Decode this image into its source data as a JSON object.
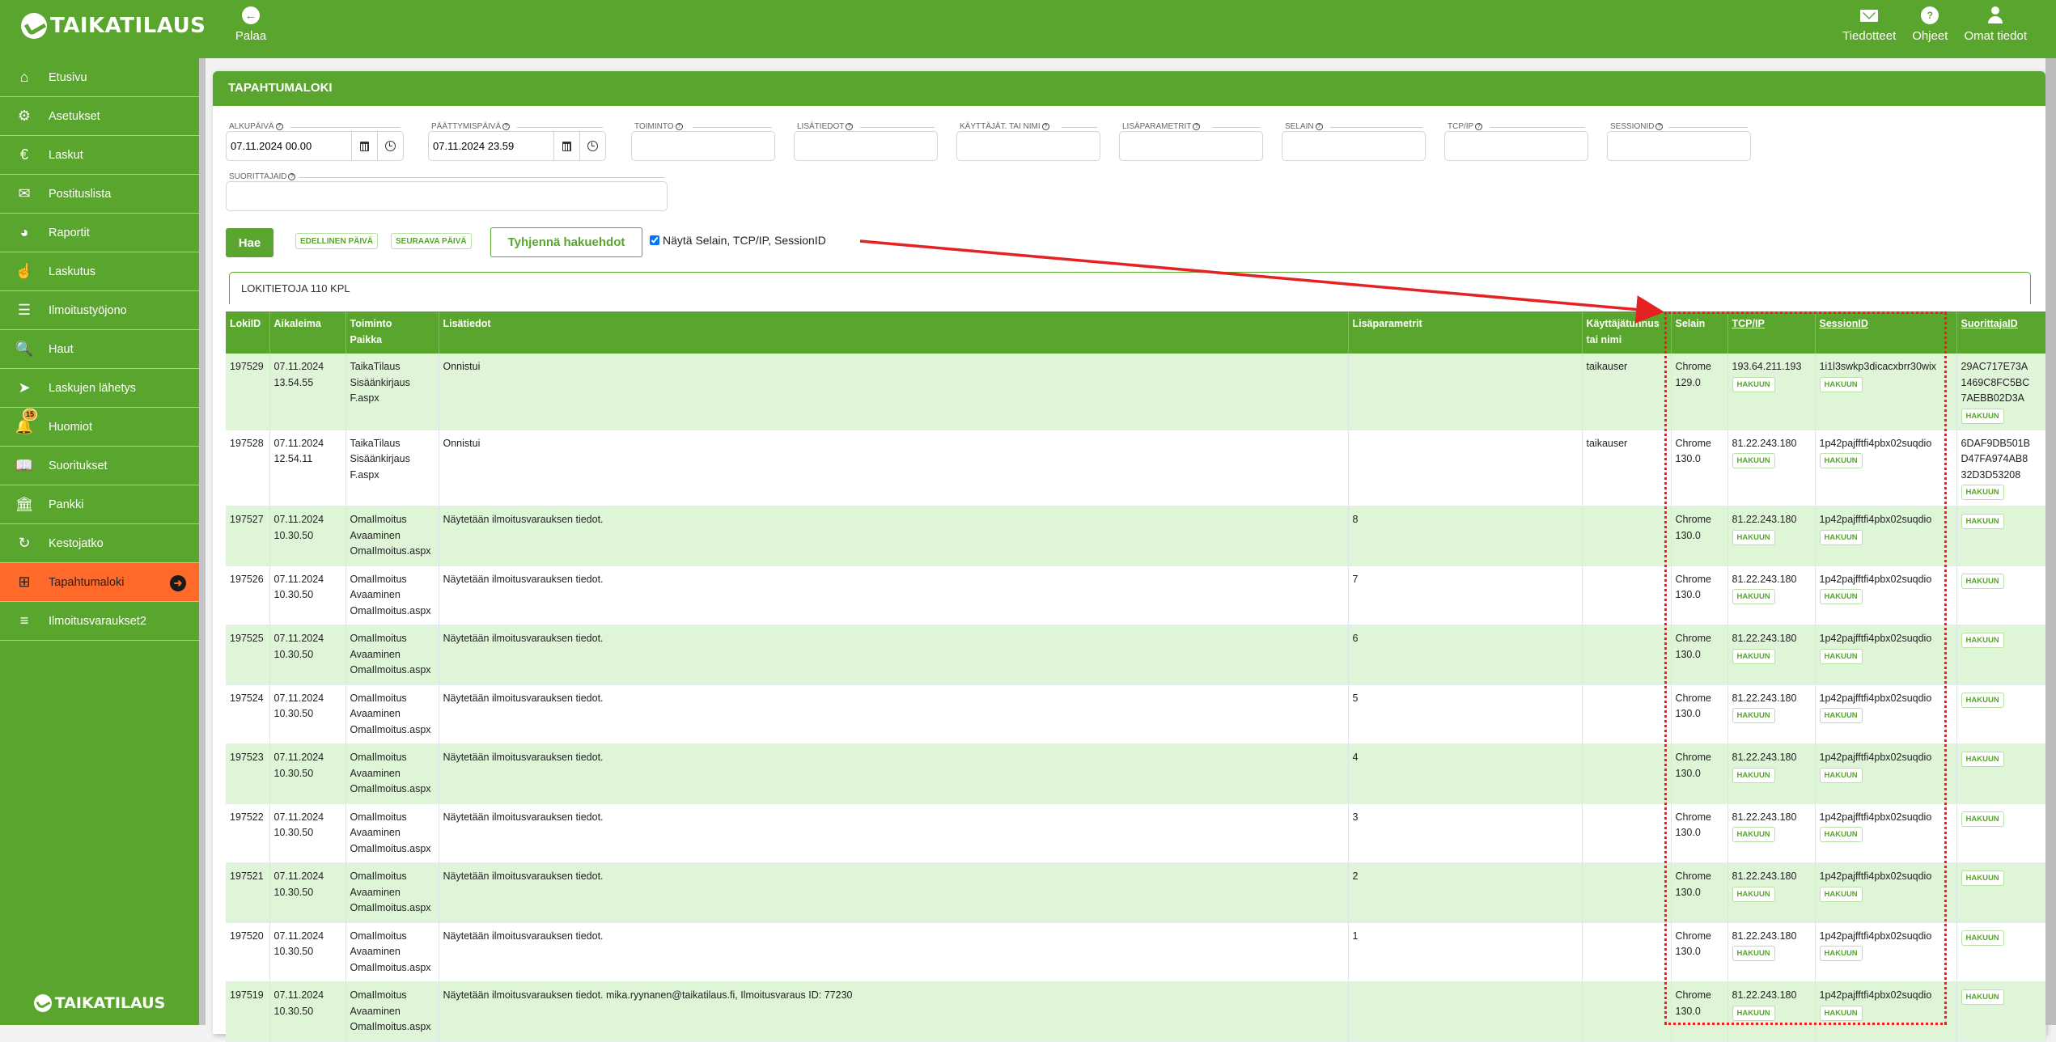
{
  "app": {
    "brand": "TAIKATILAUS",
    "back_label": "Palaa",
    "top_actions": [
      {
        "label": "Tiedotteet",
        "icon": "envelope-icon"
      },
      {
        "label": "Ohjeet",
        "icon": "question-icon"
      },
      {
        "label": "Omat tiedot",
        "icon": "user-icon"
      }
    ]
  },
  "sidebar": {
    "items": [
      {
        "label": "Etusivu",
        "icon": "home-icon"
      },
      {
        "label": "Asetukset",
        "icon": "gear-icon"
      },
      {
        "label": "Laskut",
        "icon": "euro-icon"
      },
      {
        "label": "Postituslista",
        "icon": "envelope-icon"
      },
      {
        "label": "Raportit",
        "icon": "pie-chart-icon"
      },
      {
        "label": "Laskutus",
        "icon": "thumbs-up-icon"
      },
      {
        "label": "Ilmoitustyöjono",
        "icon": "list-icon"
      },
      {
        "label": "Haut",
        "icon": "search-plus-icon"
      },
      {
        "label": "Laskujen lähetys",
        "icon": "paper-plane-icon"
      },
      {
        "label": "Huomiot",
        "icon": "bell-icon",
        "badge": "15"
      },
      {
        "label": "Suoritukset",
        "icon": "book-icon"
      },
      {
        "label": "Pankki",
        "icon": "bank-icon"
      },
      {
        "label": "Kestojatko",
        "icon": "refresh-icon"
      },
      {
        "label": "Tapahtumaloki",
        "icon": "grid-icon",
        "active": true
      },
      {
        "label": "Ilmoitusvaraukset2",
        "icon": "indent-list-icon"
      }
    ],
    "footer_brand": "TAIKATILAUS"
  },
  "page": {
    "title": "TAPAHTUMALOKI",
    "filters": {
      "alkupaiva": {
        "label": "ALKUPÄIVÄ",
        "value": "07.11.2024 00.00"
      },
      "paattymispaiva": {
        "label": "PÄÄTTYMISPÄIVÄ",
        "value": "07.11.2024 23.59"
      },
      "toiminto": {
        "label": "TOIMINTO",
        "value": ""
      },
      "lisatiedot": {
        "label": "LISÄTIEDOT",
        "value": ""
      },
      "kayttajat": {
        "label": "KÄYTTÄJÄT. TAI NIMI",
        "value": ""
      },
      "lisaparametrit": {
        "label": "LISÄPARAMETRIT",
        "value": ""
      },
      "selain": {
        "label": "SELAIN",
        "value": ""
      },
      "tcpip": {
        "label": "TCP/IP",
        "value": ""
      },
      "sessionid": {
        "label": "SESSIONID",
        "value": ""
      },
      "suorittajaid": {
        "label": "SUORITTAJAID",
        "value": ""
      }
    },
    "buttons": {
      "search": "Hae",
      "prev_day": "EDELLINEN PÄIVÄ",
      "next_day": "SEURAAVA PÄIVÄ",
      "clear": "Tyhjennä hakuehdot"
    },
    "show_extra_checkbox": {
      "label": "Näytä Selain, TCP/IP, SessionID",
      "checked": true
    },
    "count_text": "LOKITIETOJA 110 KPL",
    "hakuun_label": "HAKUUN"
  },
  "table": {
    "headers": {
      "lokiid": "LokiID",
      "aikaleima": "Aikaleima",
      "toiminto": "Toiminto\nPaikka",
      "lisatiedot": "Lisätiedot",
      "lisaparametrit": "Lisäparametrit",
      "kayttaja": "Käyttäjätunnus\ntai nimi",
      "selain": "Selain",
      "tcpip": "TCP/IP",
      "sessionid": "SessionID",
      "suorittajaid": "SuorittajaID"
    },
    "rows": [
      {
        "id": "197529",
        "time": "07.11.2024\n13.54.55",
        "action": "TaikaTilaus\nSisäänkirjaus\nF.aspx",
        "info": "Onnistui",
        "params": "",
        "user": "taikauser",
        "browser": "Chrome\n129.0",
        "ip": "193.64.211.193",
        "session": "1i1l3swkp3dicacxbrr30wix",
        "performer": "29AC717E73A\n1469C8FC5BC\n7AEBB02D3A"
      },
      {
        "id": "197528",
        "time": "07.11.2024\n12.54.11",
        "action": "TaikaTilaus\nSisäänkirjaus\nF.aspx",
        "info": "Onnistui",
        "params": "",
        "user": "taikauser",
        "browser": "Chrome\n130.0",
        "ip": "81.22.243.180",
        "session": "1p42pajfftfi4pbx02suqdio",
        "performer": "6DAF9DB501B\nD47FA974AB8\n32D3D53208"
      },
      {
        "id": "197527",
        "time": "07.11.2024\n10.30.50",
        "action": "OmaIlmoitus\nAvaaminen\nOmaIlmoitus.aspx",
        "info": "Näytetään ilmoitusvarauksen tiedot.",
        "params": "8",
        "user": "",
        "browser": "Chrome\n130.0",
        "ip": "81.22.243.180",
        "session": "1p42pajfftfi4pbx02suqdio",
        "performer": ""
      },
      {
        "id": "197526",
        "time": "07.11.2024\n10.30.50",
        "action": "OmaIlmoitus\nAvaaminen\nOmaIlmoitus.aspx",
        "info": "Näytetään ilmoitusvarauksen tiedot.",
        "params": "7",
        "user": "",
        "browser": "Chrome\n130.0",
        "ip": "81.22.243.180",
        "session": "1p42pajfftfi4pbx02suqdio",
        "performer": ""
      },
      {
        "id": "197525",
        "time": "07.11.2024\n10.30.50",
        "action": "OmaIlmoitus\nAvaaminen\nOmaIlmoitus.aspx",
        "info": "Näytetään ilmoitusvarauksen tiedot.",
        "params": "6",
        "user": "",
        "browser": "Chrome\n130.0",
        "ip": "81.22.243.180",
        "session": "1p42pajfftfi4pbx02suqdio",
        "performer": ""
      },
      {
        "id": "197524",
        "time": "07.11.2024\n10.30.50",
        "action": "OmaIlmoitus\nAvaaminen\nOmaIlmoitus.aspx",
        "info": "Näytetään ilmoitusvarauksen tiedot.",
        "params": "5",
        "user": "",
        "browser": "Chrome\n130.0",
        "ip": "81.22.243.180",
        "session": "1p42pajfftfi4pbx02suqdio",
        "performer": ""
      },
      {
        "id": "197523",
        "time": "07.11.2024\n10.30.50",
        "action": "OmaIlmoitus\nAvaaminen\nOmaIlmoitus.aspx",
        "info": "Näytetään ilmoitusvarauksen tiedot.",
        "params": "4",
        "user": "",
        "browser": "Chrome\n130.0",
        "ip": "81.22.243.180",
        "session": "1p42pajfftfi4pbx02suqdio",
        "performer": ""
      },
      {
        "id": "197522",
        "time": "07.11.2024\n10.30.50",
        "action": "OmaIlmoitus\nAvaaminen\nOmaIlmoitus.aspx",
        "info": "Näytetään ilmoitusvarauksen tiedot.",
        "params": "3",
        "user": "",
        "browser": "Chrome\n130.0",
        "ip": "81.22.243.180",
        "session": "1p42pajfftfi4pbx02suqdio",
        "performer": ""
      },
      {
        "id": "197521",
        "time": "07.11.2024\n10.30.50",
        "action": "OmaIlmoitus\nAvaaminen\nOmaIlmoitus.aspx",
        "info": "Näytetään ilmoitusvarauksen tiedot.",
        "params": "2",
        "user": "",
        "browser": "Chrome\n130.0",
        "ip": "81.22.243.180",
        "session": "1p42pajfftfi4pbx02suqdio",
        "performer": ""
      },
      {
        "id": "197520",
        "time": "07.11.2024\n10.30.50",
        "action": "OmaIlmoitus\nAvaaminen\nOmaIlmoitus.aspx",
        "info": "Näytetään ilmoitusvarauksen tiedot.",
        "params": "1",
        "user": "",
        "browser": "Chrome\n130.0",
        "ip": "81.22.243.180",
        "session": "1p42pajfftfi4pbx02suqdio",
        "performer": ""
      },
      {
        "id": "197519",
        "time": "07.11.2024\n10.30.50",
        "action": "OmaIlmoitus\nAvaaminen\nOmaIlmoitus.aspx",
        "info": "Näytetään ilmoitusvarauksen tiedot. mika.ryynanen@taikatilaus.fi, Ilmoitusvaraus ID: 77230",
        "params": "",
        "user": "",
        "browser": "Chrome\n130.0",
        "ip": "81.22.243.180",
        "session": "1p42pajfftfi4pbx02suqdio",
        "performer": ""
      }
    ]
  },
  "colors": {
    "brand_green": "#5aa52e",
    "active_orange": "#ff6a2b",
    "row_highlight": "#dff5d8",
    "annotation_red": "#e52222"
  }
}
